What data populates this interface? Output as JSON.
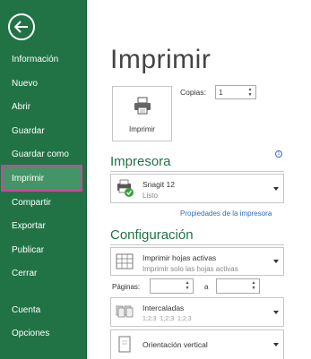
{
  "sidebar": {
    "back_label": "Volver",
    "items": [
      {
        "label": "Información"
      },
      {
        "label": "Nuevo"
      },
      {
        "label": "Abrir"
      },
      {
        "label": "Guardar"
      },
      {
        "label": "Guardar como"
      },
      {
        "label": "Imprimir"
      },
      {
        "label": "Compartir"
      },
      {
        "label": "Exportar"
      },
      {
        "label": "Publicar"
      },
      {
        "label": "Cerrar"
      },
      {
        "label": "Cuenta"
      },
      {
        "label": "Opciones"
      }
    ],
    "active_index": 5
  },
  "main": {
    "title": "Imprimir",
    "print_button_label": "Imprimir",
    "copies_label": "Copias:",
    "copies_value": "1",
    "printer_section_title": "Impresora",
    "printer": {
      "name": "Snagit 12",
      "status": "Listo"
    },
    "printer_properties_link": "Propiedades de la impresora",
    "settings_section_title": "Configuración",
    "print_what": {
      "main": "Imprimir hojas activas",
      "sub": "Imprimir solo las hojas activas"
    },
    "pages_label": "Páginas:",
    "pages_to_label": "a",
    "collation": {
      "main": "Intercaladas",
      "sub": "1;2;3   1;2;3   1;2;3"
    },
    "orientation": {
      "main": "Orientación vertical"
    }
  },
  "colors": {
    "sidebar_bg": "#217346",
    "active_item_bg": "#439467",
    "highlight_outline": "#d63fa4",
    "section_title": "#217346",
    "link": "#2f6cc0"
  }
}
